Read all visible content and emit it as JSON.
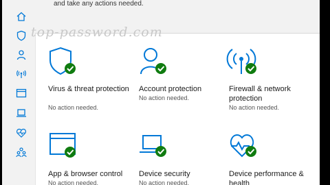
{
  "banner": {
    "text": "and take any actions needed."
  },
  "watermark": "top-password.com",
  "sidebar": {
    "items": [
      {
        "icon": "home-icon"
      },
      {
        "icon": "shield-icon"
      },
      {
        "icon": "person-icon"
      },
      {
        "icon": "wifi-antenna-icon"
      },
      {
        "icon": "app-window-icon"
      },
      {
        "icon": "laptop-icon"
      },
      {
        "icon": "heart-pulse-icon"
      },
      {
        "icon": "family-icon"
      }
    ]
  },
  "tiles": [
    {
      "title": "Virus & threat protection",
      "status": "No action needed.",
      "icon": "shield-icon"
    },
    {
      "title": "Account protection",
      "status": "No action needed.",
      "icon": "person-icon"
    },
    {
      "title": "Firewall & network protection",
      "status": "No action needed.",
      "icon": "wifi-antenna-icon"
    },
    {
      "title": "App & browser control",
      "status": "No action needed.",
      "icon": "app-window-icon"
    },
    {
      "title": "Device security",
      "status": "No action needed.",
      "icon": "laptop-icon"
    },
    {
      "title": "Device performance & health",
      "status": "",
      "icon": "heart-pulse-icon"
    }
  ],
  "colors": {
    "accent": "#0078d7",
    "check": "#107c10",
    "sidebar_bg": "#f2f2f2"
  }
}
